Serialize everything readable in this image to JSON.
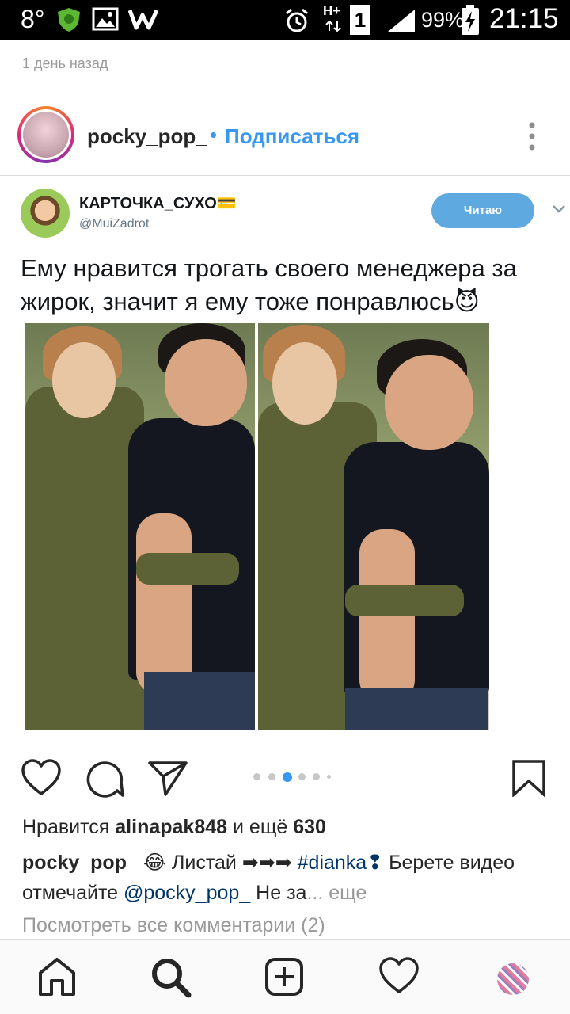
{
  "status_bar": {
    "temperature": "8°",
    "network_type": "H+",
    "sim_slot": "1",
    "battery_percent": "99%",
    "time": "21:15"
  },
  "post": {
    "time_ago": "1 день назад",
    "header": {
      "username": "pocky_pop_",
      "separator": "•",
      "follow_label": "Подписаться"
    },
    "tweet": {
      "display_name": "КАРТОЧКА_СУХО💳",
      "handle": "@MuiZadrot",
      "follow_button": "Читаю",
      "text": "Ему нравится трогать своего менеджера за жирок, значит я ему тоже понравлюсь😈"
    },
    "carousel": {
      "total_dots": 6,
      "active_index": 2
    },
    "likes": {
      "prefix": "Нравится",
      "user": "alinapak848",
      "middle": "и ещё",
      "count": "630"
    },
    "caption": {
      "username": "pocky_pop_",
      "text_1": "😂 Листай ➡➡➡",
      "hashtag": "#dianka❢",
      "text_2": "Берете видео отмечайте",
      "mention": "@pocky_pop_",
      "text_3": "Не за",
      "more_label": "... еще"
    },
    "view_comments": "Посмотреть все комментарии (2)"
  },
  "icons": {
    "like": "heart-outline-icon",
    "comment": "speech-bubble-icon",
    "share": "paper-plane-icon",
    "save": "bookmark-icon",
    "nav": [
      "home-icon",
      "search-icon",
      "add-post-icon",
      "activity-heart-icon",
      "profile-avatar"
    ]
  },
  "colors": {
    "link_blue": "#3897f0",
    "twitter_follow": "#5ea9e0",
    "carousel_active": "#3897f0",
    "carousel_inactive": "#c7c7c7"
  }
}
